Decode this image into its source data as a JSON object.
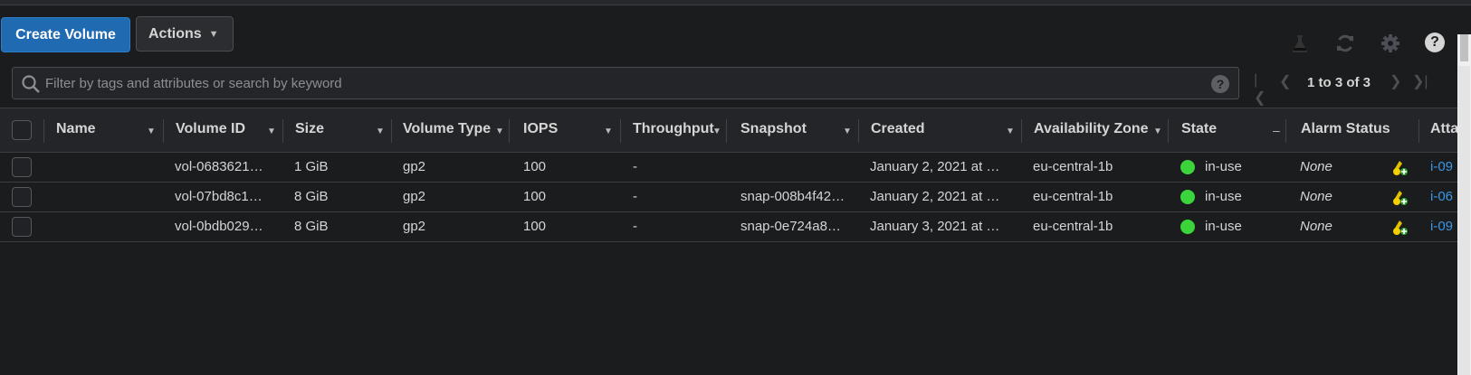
{
  "toolbar": {
    "create_volume_label": "Create Volume",
    "actions_label": "Actions",
    "icons": [
      "flask-icon",
      "refresh-icon",
      "gear-icon",
      "help-icon"
    ]
  },
  "search": {
    "placeholder": "Filter by tags and attributes or search by keyword",
    "help": "?"
  },
  "pagination": {
    "range_text": "1 to 3 of 3"
  },
  "table": {
    "columns": [
      "Name",
      "Volume ID",
      "Size",
      "Volume Type",
      "IOPS",
      "Throughput",
      "Snapshot",
      "Created",
      "Availability Zone",
      "State",
      "Alarm Status",
      "Atta"
    ],
    "rows": [
      {
        "name": "",
        "volume_id": "vol-0683621…",
        "size": "1 GiB",
        "volume_type": "gp2",
        "iops": "100",
        "throughput": "-",
        "snapshot": "",
        "created": "January 2, 2021 at …",
        "az": "eu-central-1b",
        "state": "in-use",
        "alarm_status": "None",
        "attachment": "i-09"
      },
      {
        "name": "",
        "volume_id": "vol-07bd8c1…",
        "size": "8 GiB",
        "volume_type": "gp2",
        "iops": "100",
        "throughput": "-",
        "snapshot": "snap-008b4f42…",
        "created": "January 2, 2021 at …",
        "az": "eu-central-1b",
        "state": "in-use",
        "alarm_status": "None",
        "attachment": "i-06"
      },
      {
        "name": "",
        "volume_id": "vol-0bdb029…",
        "size": "8 GiB",
        "volume_type": "gp2",
        "iops": "100",
        "throughput": "-",
        "snapshot": "snap-0e724a8…",
        "created": "January 3, 2021 at …",
        "az": "eu-central-1b",
        "state": "in-use",
        "alarm_status": "None",
        "attachment": "i-09"
      }
    ]
  },
  "colors": {
    "background": "#1b1c1e",
    "primary_button": "#1f6ab1",
    "state_in_use": "#3bd53b",
    "link": "#3c96e6"
  }
}
